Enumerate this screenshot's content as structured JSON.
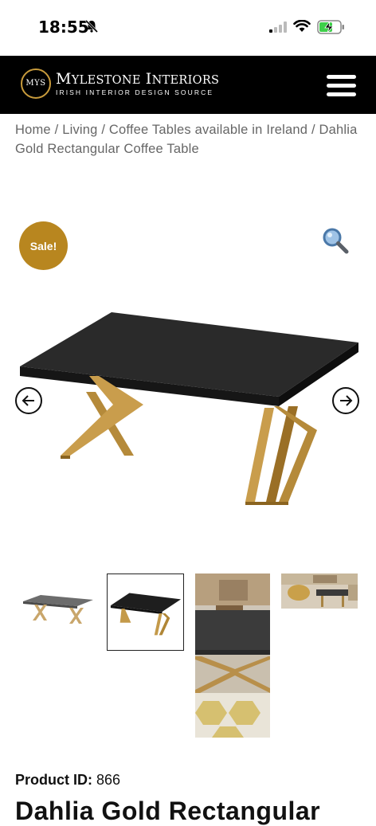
{
  "status_bar": {
    "time": "18:55"
  },
  "header": {
    "logo_badge": "MYS",
    "brand_name": "Mylestone Interiors",
    "tagline": "IRISH INTERIOR DESIGN SOURCE",
    "menu_icon": "hamburger-menu-icon",
    "background": "#000000"
  },
  "breadcrumb": {
    "items": [
      "Home",
      "Living",
      "Coffee Tables available in Ireland",
      "Dahlia Gold Rectangular Coffee Table"
    ],
    "separator": "/"
  },
  "gallery": {
    "sale_badge": "Sale!",
    "sale_color": "#b8861f",
    "zoom_icon": "magnifier-icon",
    "prev_icon": "arrow-left-icon",
    "next_icon": "arrow-right-icon",
    "selected_thumbnail": 2
  },
  "product": {
    "id_label": "Product ID:",
    "id_value": "866",
    "title": "Dahlia Gold Rectangular"
  }
}
